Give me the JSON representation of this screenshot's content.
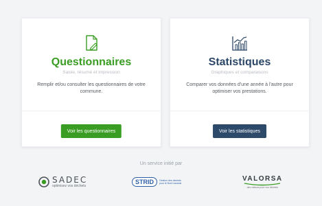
{
  "cards": {
    "questionnaires": {
      "title": "Questionnaires",
      "subtitle": "Saisie, résumé et impression",
      "description": "Remplir et/ou consulter les questionnaires de votre commune.",
      "button_label": "Voir les questionnaires",
      "icon": "document-pen-icon",
      "accent_color": "#3a9d23"
    },
    "statistiques": {
      "title": "Statistiques",
      "subtitle": "Graphiques et comparaisons",
      "description": "Comparer vos données d'une année à l'autre pour optimiser vos prestations.",
      "button_label": "Voir les statistiques",
      "icon": "chart-icon",
      "accent_color": "#2c4767"
    }
  },
  "footer": {
    "service_text": "Un service initié par",
    "logos": {
      "sadec": {
        "name": "SADEC",
        "tagline": "optimisez vos déchets"
      },
      "strid": {
        "name": "STRID",
        "tagline": "Gestion des déchets pour le Nord vaudois"
      },
      "valorsa": {
        "name": "VALORSA",
        "tagline": "des valeurs pour vos déchets"
      }
    }
  }
}
